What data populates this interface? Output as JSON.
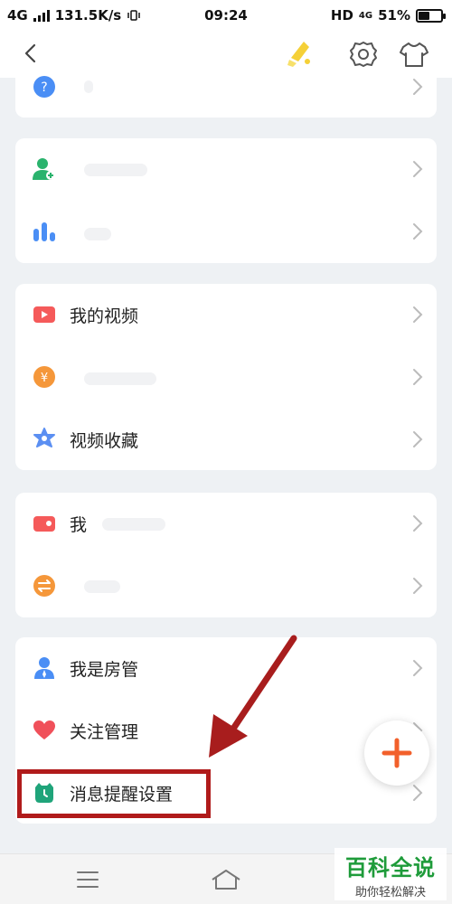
{
  "status_bar": {
    "network": "4G",
    "speed": "131.5K/s",
    "time": "09:24",
    "hd": "HD",
    "net2": "4G",
    "battery": "51%",
    "battery_level": 0.51
  },
  "menu": {
    "item_help": "",
    "item_add_user": "",
    "item_stats": "",
    "item_my_videos": "我的视频",
    "item_coins": "",
    "item_favorites": "视频收藏",
    "item_wallet": "我",
    "item_exchange": "",
    "item_room_admin": "我是房管",
    "item_follow_manage": "关注管理",
    "item_notify_settings": "消息提醒设置"
  },
  "watermark": {
    "title": "百科全说",
    "subtitle": "助你轻松解决"
  },
  "colors": {
    "accent_orange": "#f2602b",
    "highlight_red": "#b01b1b",
    "watermark_green": "#1e9b3a"
  },
  "icons": [
    "back-arrow-icon",
    "dress-up-icon",
    "settings-gear-icon",
    "tshirt-icon",
    "help-icon",
    "add-user-icon",
    "stats-bars-icon",
    "video-icon",
    "coin-icon",
    "flower-favorite-icon",
    "wallet-icon",
    "exchange-icon",
    "admin-user-icon",
    "heart-icon",
    "alarm-clock-icon",
    "plus-icon",
    "menu-icon",
    "home-icon"
  ]
}
